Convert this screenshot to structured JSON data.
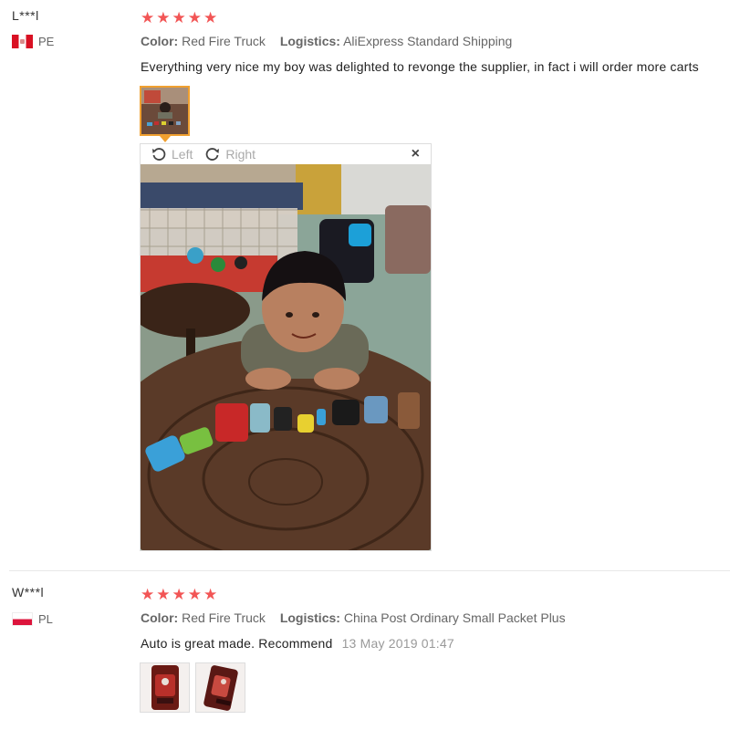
{
  "reviews": [
    {
      "buyer": "L***l",
      "country": "PE",
      "rating_stars": "★★★★★",
      "color_key": "Color:",
      "color_val": "Red Fire Truck",
      "logistics_key": "Logistics:",
      "logistics_val": "AliExpress Standard Shipping",
      "feedback": "Everything very nice my boy was delighted to revonge the supplier, in fact i will order more carts"
    },
    {
      "buyer": "W***l",
      "country": "PL",
      "rating_stars": "★★★★★",
      "color_key": "Color:",
      "color_val": "Red Fire Truck",
      "logistics_key": "Logistics:",
      "logistics_val": "China Post Ordinary Small Packet Plus",
      "feedback": "Auto is great made. Recommend",
      "date": "13 May 2019 01:47"
    }
  ],
  "viewer": {
    "rotate_left": "Left",
    "rotate_right": "Right",
    "close": "×"
  },
  "colors": {
    "star": "#f25555",
    "active_thumb_border": "#f0a030"
  },
  "icons": [
    "rotate-left-icon",
    "rotate-right-icon",
    "close-icon",
    "flag-pe-icon",
    "flag-pl-icon"
  ]
}
